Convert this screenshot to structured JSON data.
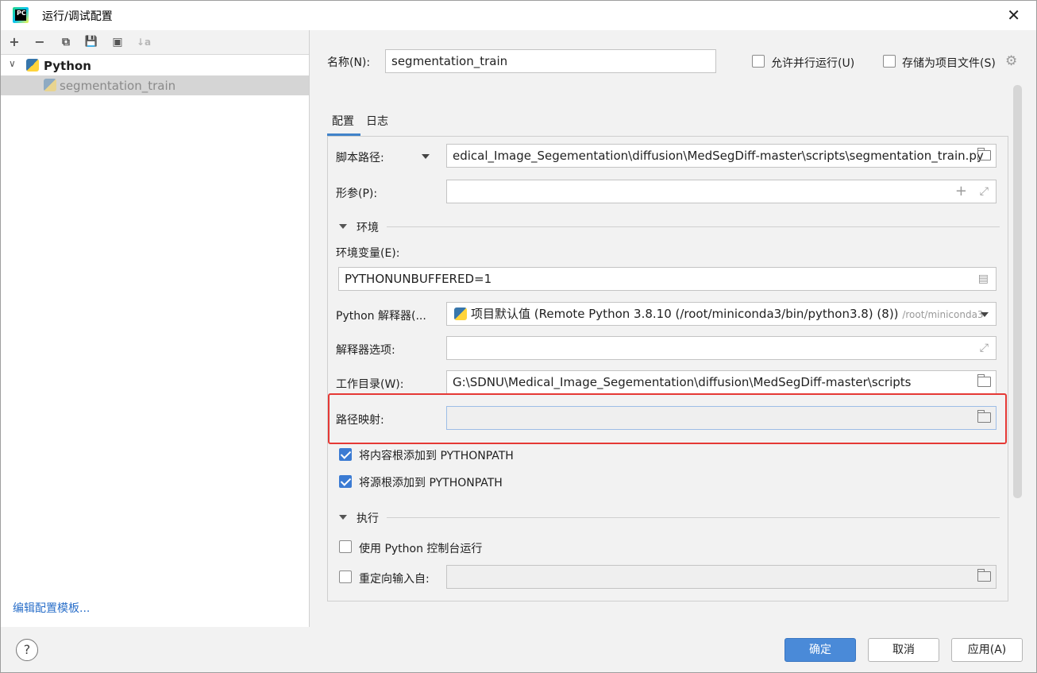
{
  "window": {
    "title": "运行/调试配置"
  },
  "toolbar": {
    "add": "+",
    "remove": "−",
    "copy": "⧉",
    "save": "💾",
    "folder": "▣",
    "sort": "↓a"
  },
  "tree": {
    "group_label": "Python",
    "item_label": "segmentation_train"
  },
  "edit_templates_link": "编辑配置模板...",
  "form": {
    "name_label": "名称(N):",
    "name_value": "segmentation_train",
    "allow_parallel_label": "允许并行运行(U)",
    "store_as_project_label": "存储为项目文件(S)",
    "tabs": [
      "配置",
      "日志"
    ],
    "script_path_label": "脚本路径:",
    "script_path_value": "edical_Image_Segementation\\diffusion\\MedSegDiff-master\\scripts\\segmentation_train.py",
    "params_label": "形参(P):",
    "params_value": "",
    "env_section": "环境",
    "env_vars_label": "环境变量(E):",
    "env_vars_value": "PYTHONUNBUFFERED=1",
    "interpreter_label": "Python 解释器(...",
    "interpreter_value": "项目默认值 (Remote Python 3.8.10 (/root/miniconda3/bin/python3.8) (8))",
    "interpreter_hint": "/root/miniconda3",
    "interpreter_options_label": "解释器选项:",
    "workdir_label": "工作目录(W):",
    "workdir_value": "G:\\SDNU\\Medical_Image_Segementation\\diffusion\\MedSegDiff-master\\scripts",
    "path_mapping_label": "路径映射:",
    "add_content_roots_label": "将内容根添加到 PYTHONPATH",
    "add_source_roots_label": "将源根添加到 PYTHONPATH",
    "exec_section": "执行",
    "use_console_label": "使用 Python 控制台运行",
    "redirect_input_label": "重定向输入自:"
  },
  "buttons": {
    "help": "?",
    "ok": "确定",
    "cancel": "取消",
    "apply": "应用(A)"
  },
  "colors": {
    "accent": "#4a8ad8",
    "highlight": "#e53935",
    "link": "#2a6fc9"
  }
}
